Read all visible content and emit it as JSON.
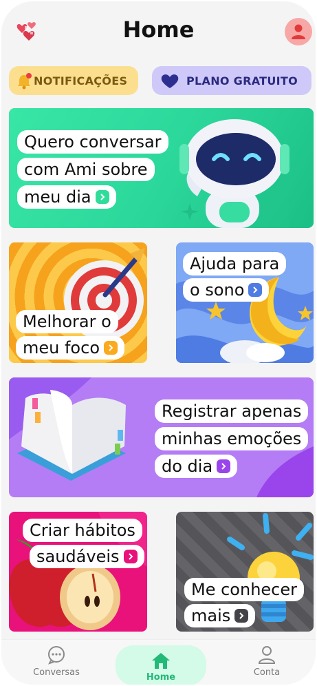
{
  "header": {
    "title": "Home"
  },
  "pills": {
    "notifications": "NOTIFICAÇÕES",
    "plan": "PLANO GRATUITO"
  },
  "cards": {
    "ami": [
      "Quero conversar",
      "com Ami sobre",
      "meu dia"
    ],
    "focus": [
      "Melhorar o",
      "meu foco"
    ],
    "sleep": [
      "Ajuda para",
      "o sono"
    ],
    "emotions": [
      "Registrar apenas",
      "minhas emoções",
      "do dia"
    ],
    "habits": [
      "Criar hábitos",
      "saudáveis"
    ],
    "know": [
      "Me conhecer",
      "mais"
    ]
  },
  "nav": {
    "conversas": "Conversas",
    "home": "Home",
    "conta": "Conta"
  },
  "colors": {
    "ami_green": "#2fdc9a",
    "focus_orange": "#fba91e",
    "sleep_blue": "#7fa8f5",
    "emotions_purple": "#b47df5",
    "habits_pink": "#e9127a",
    "know_gray": "#5f5f62",
    "home_highlight": "#d4fae8",
    "home_green": "#23b978"
  }
}
